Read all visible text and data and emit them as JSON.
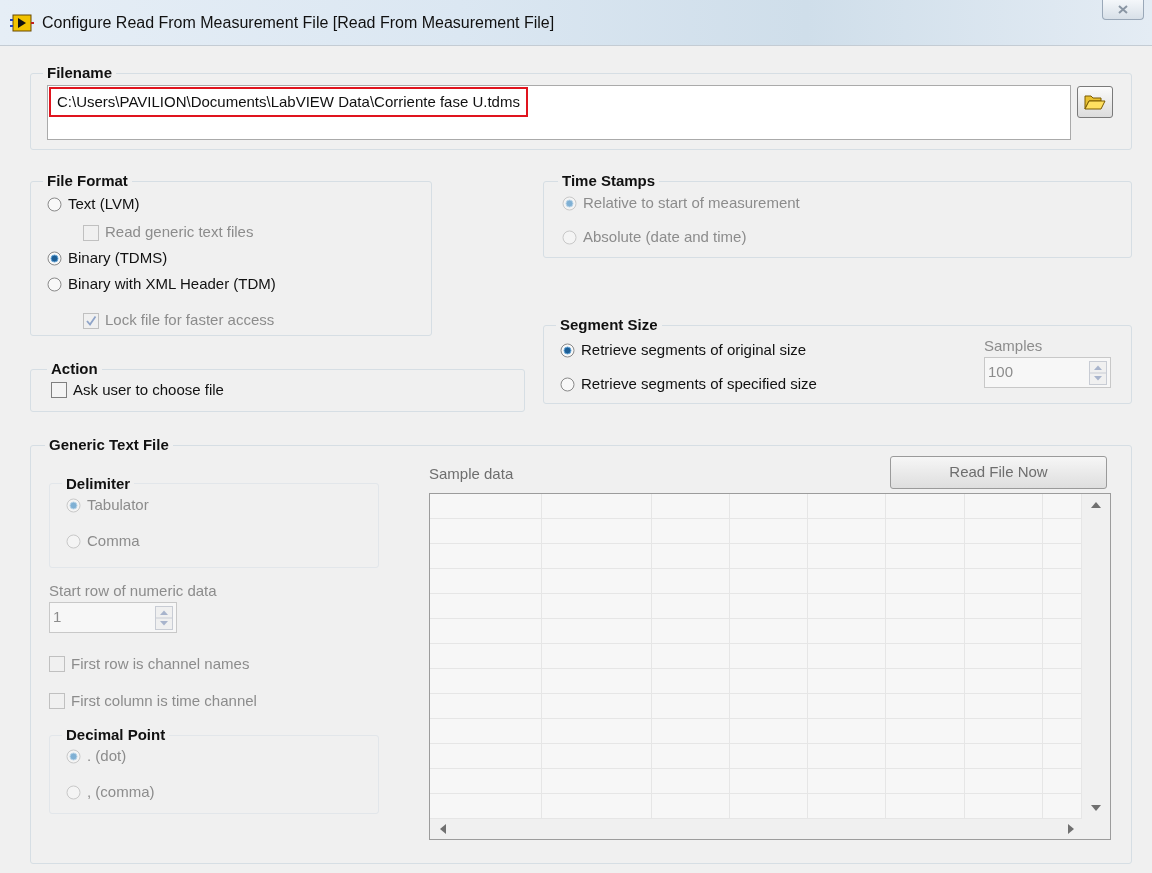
{
  "window": {
    "title": "Configure Read From Measurement File [Read From Measurement File]"
  },
  "filename": {
    "label": "Filename",
    "value": "C:\\Users\\PAVILION\\Documents\\LabVIEW Data\\Corriente fase U.tdms",
    "highlighted": true
  },
  "file_format": {
    "label": "File Format",
    "options": [
      {
        "kind": "radio",
        "label": "Text (LVM)",
        "selected": false,
        "disabled": false
      },
      {
        "kind": "checkbox",
        "label": "Read generic text files",
        "checked": false,
        "disabled": true
      },
      {
        "kind": "radio",
        "label": "Binary (TDMS)",
        "selected": true,
        "disabled": false
      },
      {
        "kind": "radio",
        "label": "Binary with XML Header (TDM)",
        "selected": false,
        "disabled": false
      },
      {
        "kind": "checkbox",
        "label": "Lock file for faster access",
        "checked": true,
        "disabled": true
      }
    ]
  },
  "time_stamps": {
    "label": "Time Stamps",
    "disabled": true,
    "options": [
      {
        "label": "Relative to start of measurement",
        "selected": true
      },
      {
        "label": "Absolute (date and time)",
        "selected": false
      }
    ]
  },
  "action": {
    "label": "Action",
    "options": [
      {
        "label": "Ask user to choose file",
        "checked": false
      }
    ]
  },
  "segment_size": {
    "label": "Segment Size",
    "disabled": false,
    "options": [
      {
        "label": "Retrieve segments of original size",
        "selected": true
      },
      {
        "label": "Retrieve segments of specified size",
        "selected": false
      }
    ],
    "samples": {
      "label": "Samples",
      "value": "100",
      "disabled": true
    }
  },
  "generic_text_file": {
    "label": "Generic Text File",
    "disabled": true,
    "delimiter": {
      "label": "Delimiter",
      "options": [
        {
          "label": "Tabulator",
          "selected": true
        },
        {
          "label": "Comma",
          "selected": false
        }
      ]
    },
    "start_row": {
      "label": "Start row of numeric data",
      "value": "1"
    },
    "checkboxes": [
      {
        "label": "First row is channel names",
        "checked": false
      },
      {
        "label": "First column is time channel",
        "checked": false
      }
    ],
    "decimal_point": {
      "label": "Decimal Point",
      "options": [
        {
          "label": ". (dot)",
          "selected": true
        },
        {
          "label": ", (comma)",
          "selected": false
        }
      ]
    },
    "read_button": "Read File Now",
    "sample_data": {
      "label": "Sample data"
    }
  }
}
